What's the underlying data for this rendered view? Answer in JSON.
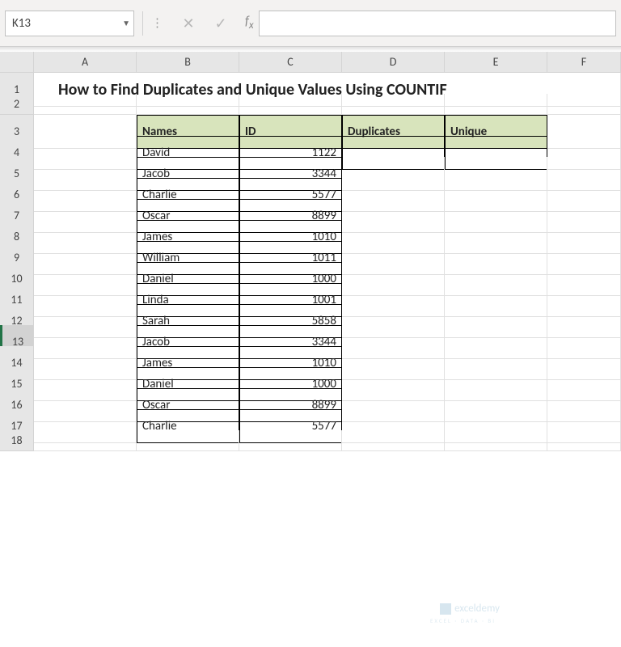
{
  "nameBox": "K13",
  "formulaValue": "",
  "columns": [
    "A",
    "B",
    "C",
    "D",
    "E",
    "F"
  ],
  "rowNumbers": [
    1,
    2,
    3,
    4,
    5,
    6,
    7,
    8,
    9,
    10,
    11,
    12,
    13,
    14,
    15,
    16,
    17,
    18
  ],
  "activeRow": 13,
  "title": "How to Find Duplicates and Unique Values Using COUNTIF",
  "headers": {
    "names": "Names",
    "id": "ID",
    "duplicates": "Duplicates",
    "unique": "Unique"
  },
  "rows": [
    {
      "name": "David",
      "id": "1122"
    },
    {
      "name": "Jacob",
      "id": "3344"
    },
    {
      "name": "Charlie",
      "id": "5577"
    },
    {
      "name": "Oscar",
      "id": "8899"
    },
    {
      "name": "James",
      "id": "1010"
    },
    {
      "name": "William",
      "id": "1011"
    },
    {
      "name": "Daniel",
      "id": "1000"
    },
    {
      "name": "Linda",
      "id": "1001"
    },
    {
      "name": "Sarah",
      "id": "5858"
    },
    {
      "name": "Jacob",
      "id": "3344"
    },
    {
      "name": "James",
      "id": "1010"
    },
    {
      "name": "Daniel",
      "id": "1000"
    },
    {
      "name": "Oscar",
      "id": "8899"
    },
    {
      "name": "Charlie",
      "id": "5577"
    }
  ],
  "watermark": {
    "main": "exceldemy",
    "sub": "EXCEL · DATA · BI"
  },
  "chart_data": {
    "type": "table",
    "title": "How to Find Duplicates and Unique Values Using COUNTIF",
    "columns": [
      "Names",
      "ID",
      "Duplicates",
      "Unique"
    ],
    "data": [
      [
        "David",
        1122,
        "",
        ""
      ],
      [
        "Jacob",
        3344,
        null,
        null
      ],
      [
        "Charlie",
        5577,
        null,
        null
      ],
      [
        "Oscar",
        8899,
        null,
        null
      ],
      [
        "James",
        1010,
        null,
        null
      ],
      [
        "William",
        1011,
        null,
        null
      ],
      [
        "Daniel",
        1000,
        null,
        null
      ],
      [
        "Linda",
        1001,
        null,
        null
      ],
      [
        "Sarah",
        5858,
        null,
        null
      ],
      [
        "Jacob",
        3344,
        null,
        null
      ],
      [
        "James",
        1010,
        null,
        null
      ],
      [
        "Daniel",
        1000,
        null,
        null
      ],
      [
        "Oscar",
        8899,
        null,
        null
      ],
      [
        "Charlie",
        5577,
        null,
        null
      ]
    ]
  }
}
